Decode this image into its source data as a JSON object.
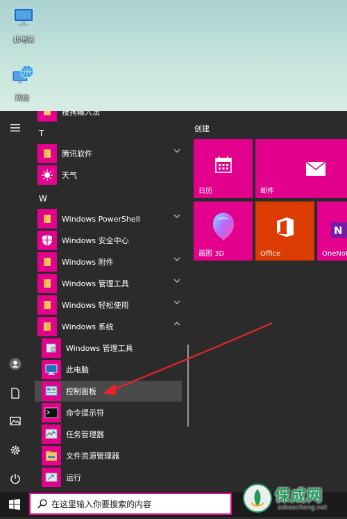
{
  "desktop": {
    "icons": [
      {
        "label": "此电脑",
        "icon": "this-pc-icon"
      },
      {
        "label": "网络",
        "icon": "network-icon"
      }
    ]
  },
  "app_list": {
    "partial_top": {
      "label": "搜狗输入法"
    },
    "section_t": "T",
    "t_items": [
      {
        "label": "腾讯软件",
        "icon": "folder-icon"
      },
      {
        "label": "天气",
        "icon": "weather-sun-icon"
      }
    ],
    "section_w": "W",
    "w_items": [
      {
        "label": "Windows PowerShell",
        "icon": "folder-icon"
      },
      {
        "label": "Windows 安全中心",
        "icon": "shield-icon"
      },
      {
        "label": "Windows 附件",
        "icon": "folder-icon"
      },
      {
        "label": "Windows 管理工具",
        "icon": "folder-icon"
      },
      {
        "label": "Windows 轻松使用",
        "icon": "folder-icon"
      },
      {
        "label": "Windows 系统",
        "icon": "folder-icon"
      }
    ],
    "system_sub": [
      {
        "label": "Windows 管理工具",
        "icon": "admin-tools-icon"
      },
      {
        "label": "此电脑",
        "icon": "this-pc-icon"
      },
      {
        "label": "控制面板",
        "icon": "control-panel-icon"
      },
      {
        "label": "命令提示符",
        "icon": "cmd-icon"
      },
      {
        "label": "任务管理器",
        "icon": "task-manager-icon"
      },
      {
        "label": "文件资源管理器",
        "icon": "file-explorer-icon"
      },
      {
        "label": "运行",
        "icon": "run-icon"
      }
    ]
  },
  "tiles": {
    "group_title": "创建",
    "items": [
      {
        "label": "日历",
        "icon": "calendar-icon",
        "color": "#e3008c"
      },
      {
        "label": "邮件",
        "icon": "mail-icon",
        "color": "#e3008c"
      },
      {
        "label": "画图 3D",
        "icon": "paint3d-icon",
        "color": "#e3008c"
      },
      {
        "label": "Office",
        "icon": "office-icon",
        "color": "#dc3b01"
      },
      {
        "label": "OneNote",
        "icon": "onenote-icon",
        "color": "#e3008c"
      }
    ]
  },
  "taskbar": {
    "search_placeholder": "在这里输入你要搜索的内容"
  },
  "watermark": {
    "title": "保成网",
    "url": "zsbaocheng.net"
  },
  "colors": {
    "accent": "#e3008c",
    "office": "#dc3b01",
    "arrow": "#e8232a",
    "menu_bg": "#2b2b2b",
    "taskbar_bg": "#1b1b1b"
  }
}
